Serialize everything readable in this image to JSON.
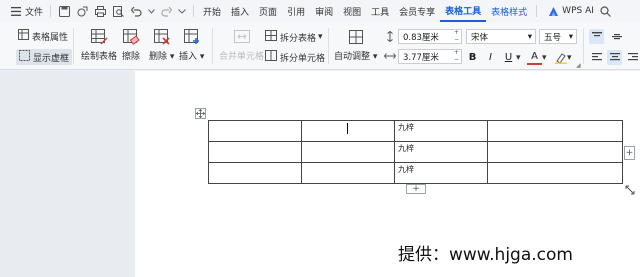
{
  "menubar": {
    "hamburger_icon": "menu-icon",
    "file_label": "文件",
    "tabs": [
      "开始",
      "插入",
      "页面",
      "引用",
      "审阅",
      "视图",
      "工具",
      "会员专享",
      "表格工具",
      "表格样式"
    ],
    "active_tab": "表格工具",
    "wps_ai_label": "WPS AI"
  },
  "ribbon": {
    "table_properties": "表格属性",
    "show_gridlines": "显示虚框",
    "draw_table": "绘制表格",
    "erase": "擦除",
    "delete": "删除",
    "insert": "插入",
    "merge_cells": "合并单元格",
    "split_table": "拆分表格",
    "split_cells": "拆分单元格",
    "auto_fit": "自动调整",
    "row_height": "0.83厘米",
    "col_width": "3.77厘米",
    "font_name": "宋体",
    "font_size": "五号",
    "bold": "B",
    "italic": "I",
    "underline": "U",
    "font_color_letter": "A"
  },
  "table": {
    "rows": [
      [
        "",
        "",
        "九梓",
        ""
      ],
      [
        "",
        "",
        "九梓",
        ""
      ],
      [
        "",
        "",
        "九梓",
        ""
      ]
    ]
  },
  "footer": "提供：www.hjga.com",
  "colors": {
    "accent": "#1a5fd8",
    "doc_bg": "#ffffff",
    "pane_bg": "#e8ecf0"
  }
}
